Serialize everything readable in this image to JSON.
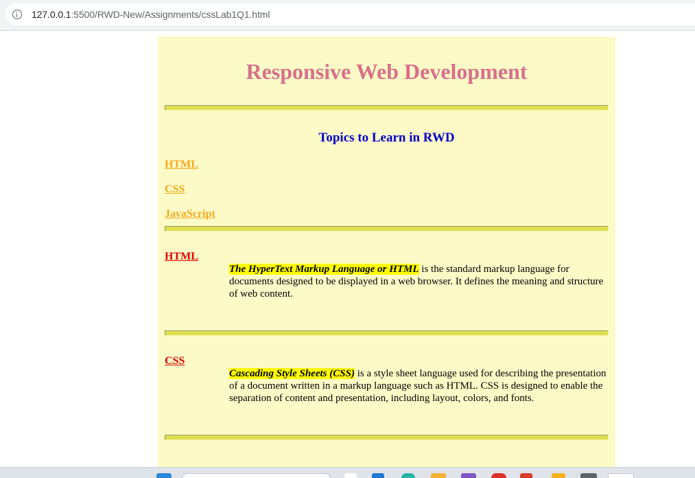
{
  "browser": {
    "url_host": "127.0.0.1",
    "url_path": ":5500/RWD-New/Assignments/cssLab1Q1.html"
  },
  "page": {
    "title": "Responsive Web Development",
    "subtitle": "Topics to Learn in RWD",
    "topics": [
      "HTML",
      "CSS",
      "JavaScript"
    ],
    "sections": [
      {
        "heading": "HTML",
        "highlight": "The HyperText Markup Language or HTML",
        "text": " is the standard markup language for documents designed to be displayed in a web browser. It defines the meaning and structure of web content."
      },
      {
        "heading": "CSS",
        "highlight": "Cascading Style Sheets (CSS)",
        "text": " is a style sheet language used for describing the presentation of a document written in a markup language such as HTML. CSS is designed to enable the separation of content and presentation, including layout, colors, and fonts."
      }
    ]
  },
  "colors": {
    "page_bg": "#fcfbc7",
    "title": "#d8708b",
    "subtitle": "#0000cc",
    "topic_links": "#f4a71c",
    "section_links": "#dd0000",
    "highlight": "#ffff00",
    "rule": "#dfdf4f"
  },
  "taskbar": {
    "icons": [
      "windows-start-icon",
      "search-box",
      "app-icon",
      "app-icon",
      "app-icon",
      "app-icon",
      "app-icon",
      "app-icon",
      "app-icon",
      "app-icon",
      "app-icon",
      "app-icon"
    ]
  }
}
